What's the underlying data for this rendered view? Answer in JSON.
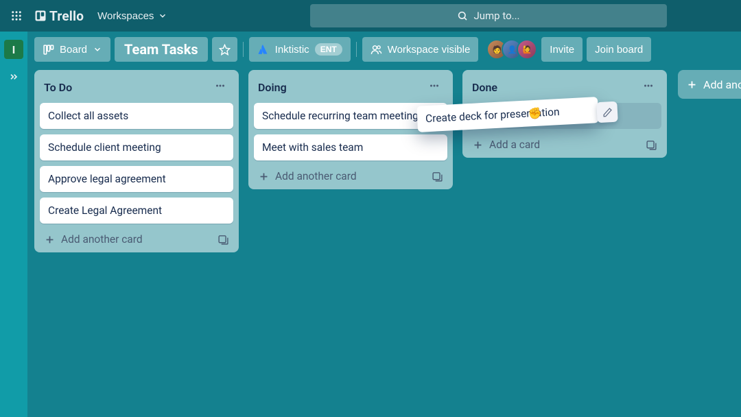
{
  "topnav": {
    "workspaces_label": "Workspaces",
    "search_placeholder": "Jump to..."
  },
  "leftrail": {
    "workspace_initial": "I"
  },
  "boardhdr": {
    "view_label": "Board",
    "board_title": "Team Tasks",
    "org_label": "Inktistic",
    "org_chip": "ENT",
    "visibility_label": "Workspace visible",
    "invite_label": "Invite",
    "join_label": "Join board"
  },
  "lists": [
    {
      "title": "To Do",
      "add_label": "Add another card",
      "cards": [
        "Collect all assets",
        "Schedule client meeting",
        "Approve legal agreement",
        "Create Legal Agreement"
      ]
    },
    {
      "title": "Doing",
      "add_label": "Add another card",
      "cards": [
        "Schedule recurring team meetings",
        "Meet with sales team"
      ]
    },
    {
      "title": "Done",
      "add_label": "Add a card",
      "cards": []
    }
  ],
  "add_list_label": "Add another list",
  "dragging_card": {
    "text": "Create deck for presentation"
  }
}
